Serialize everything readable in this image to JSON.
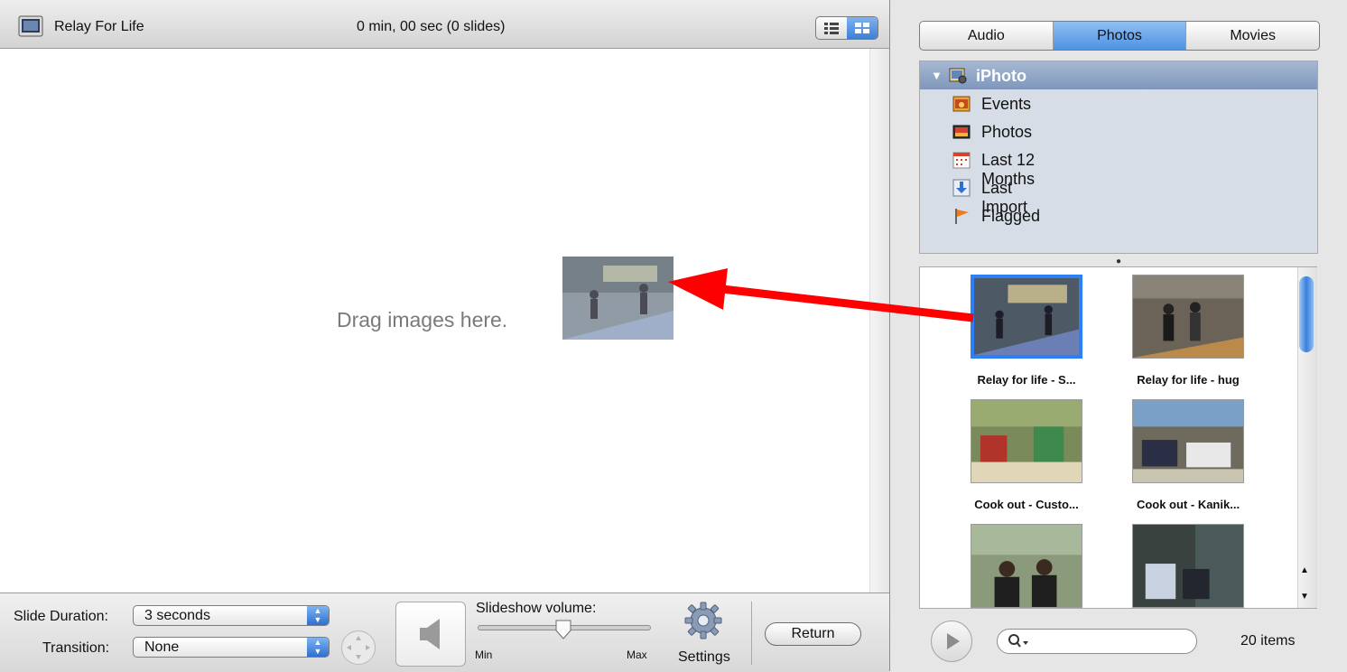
{
  "project": {
    "title": "Relay For Life",
    "duration_readout": "0 min, 00 sec  (0 slides)",
    "view_mode": "grid"
  },
  "drop_area": {
    "hint": "Drag images here."
  },
  "controls": {
    "slide_duration_label": "Slide Duration:",
    "slide_duration_value": "3 seconds",
    "transition_label": "Transition:",
    "transition_value": "None",
    "volume_label": "Slideshow volume:",
    "volume_min": "Min",
    "volume_max": "Max",
    "volume_level": 0.5,
    "settings_label": "Settings",
    "return_label": "Return"
  },
  "browser": {
    "tabs": [
      {
        "label": "Audio",
        "selected": false
      },
      {
        "label": "Photos",
        "selected": true
      },
      {
        "label": "Movies",
        "selected": false
      }
    ],
    "library": {
      "label": "iPhoto",
      "expanded": true,
      "items": [
        {
          "label": "Events",
          "icon": "events-icon"
        },
        {
          "label": "Photos",
          "icon": "photos-icon"
        },
        {
          "label": "Last 12 Months",
          "icon": "calendar-icon"
        },
        {
          "label": "Last Import",
          "icon": "import-icon"
        },
        {
          "label": "Flagged",
          "icon": "flag-icon"
        }
      ]
    },
    "photos": [
      {
        "caption": "Relay for life - S...",
        "selected": true
      },
      {
        "caption": "Relay for life - hug",
        "selected": false
      },
      {
        "caption": "Cook out - Custo...",
        "selected": false
      },
      {
        "caption": "Cook out - Kanik...",
        "selected": false
      },
      {
        "caption": "",
        "selected": false
      },
      {
        "caption": "",
        "selected": false
      }
    ],
    "search_placeholder": "",
    "item_count": "20 items"
  },
  "colors": {
    "accent": "#3d7fd6",
    "selection_border": "#2d7ff5",
    "arrow": "#ff0000"
  }
}
